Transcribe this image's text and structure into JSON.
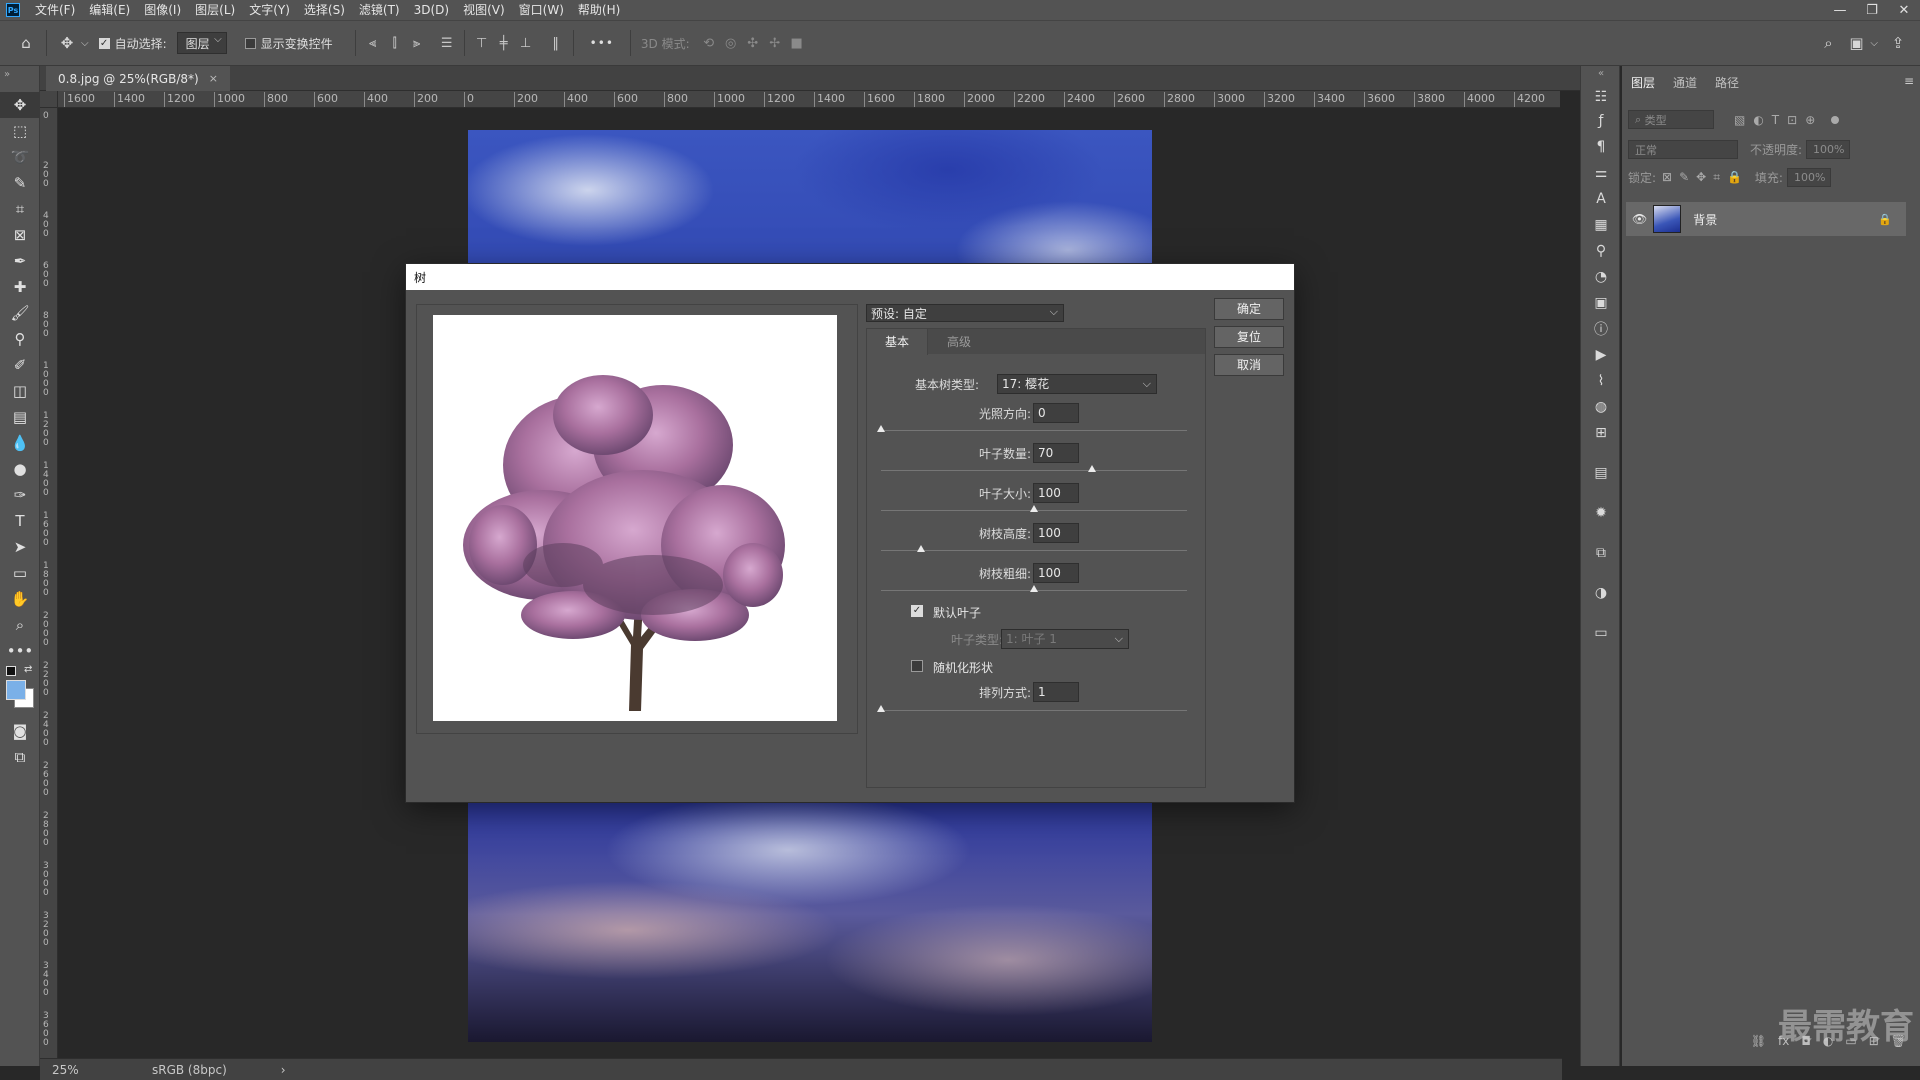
{
  "app": {
    "logo": "Ps"
  },
  "menu": [
    "文件(F)",
    "编辑(E)",
    "图像(I)",
    "图层(L)",
    "文字(Y)",
    "选择(S)",
    "滤镜(T)",
    "3D(D)",
    "视图(V)",
    "窗口(W)",
    "帮助(H)"
  ],
  "window_controls": {
    "minimize": "—",
    "restore": "❐",
    "close": "✕"
  },
  "options_bar": {
    "auto_select_label": "自动选择:",
    "auto_select_checked": true,
    "auto_select_target": "图层",
    "show_transform_label": "显示变换控件",
    "show_transform_checked": false,
    "more": "•••",
    "mode_3d_label": "3D 模式:"
  },
  "document_tab": {
    "title": "0.8.jpg @ 25%(RGB/8*)",
    "close": "×"
  },
  "ruler_h": [
    "1600",
    "1400",
    "1200",
    "1000",
    "800",
    "600",
    "400",
    "200",
    "0",
    "200",
    "400",
    "600",
    "800",
    "1000",
    "1200",
    "1400",
    "1600",
    "1800",
    "2000",
    "2200",
    "2400",
    "2600",
    "2800",
    "3000",
    "3200",
    "3400",
    "3600",
    "3800",
    "4000",
    "4200"
  ],
  "ruler_v": [
    "0",
    "2 0 0",
    "4 0 0",
    "6 0 0",
    "8 0 0",
    "1 0 0 0",
    "1 2 0 0",
    "1 4 0 0",
    "1 6 0 0",
    "1 8 0 0",
    "2 0 0 0",
    "2 2 0 0",
    "2 4 0 0",
    "2 6 0 0",
    "2 8 0 0",
    "3 0 0 0",
    "3 2 0 0",
    "3 4 0 0",
    "3 6 0 0"
  ],
  "status": {
    "zoom": "25%",
    "profile": "sRGB (8bpc)",
    "arrow": "›"
  },
  "layers_panel": {
    "tabs": [
      "图层",
      "通道",
      "路径"
    ],
    "filter_placeholder": "类型",
    "blend_mode": "正常",
    "opacity_label": "不透明度:",
    "opacity_value": "100%",
    "lock_label": "锁定:",
    "fill_label": "填充:",
    "fill_value": "100%",
    "layer_name": "背景",
    "footer_icons": [
      "⛓",
      "fx",
      "◘",
      "◐",
      "▭",
      "⊞",
      "🗑"
    ]
  },
  "dialog": {
    "title": "树",
    "preset": "预设: 自定",
    "tabs": [
      "基本",
      "高级"
    ],
    "active_tab": "基本",
    "base_tree_type_label": "基本树类型:",
    "base_tree_type_value": "17: 樱花",
    "params": [
      {
        "label": "光照方向:",
        "value": "0",
        "slider": 0.0
      },
      {
        "label": "叶子数量:",
        "value": "70",
        "slider": 0.69
      },
      {
        "label": "叶子大小:",
        "value": "100",
        "slider": 0.5
      },
      {
        "label": "树枝高度:",
        "value": "100",
        "slider": 0.13
      },
      {
        "label": "树枝粗细:",
        "value": "100",
        "slider": 0.5
      }
    ],
    "default_leaves_label": "默认叶子",
    "default_leaves_checked": true,
    "leaf_type_label": "叶子类型:",
    "leaf_type_value": "1: 叶子 1",
    "randomize_label": "随机化形状",
    "randomize_checked": false,
    "arrangement_label": "排列方式:",
    "arrangement_value": "1",
    "arrangement_slider": 0.0,
    "buttons": {
      "ok": "确定",
      "reset": "复位",
      "cancel": "取消"
    }
  },
  "watermark": "最需教育",
  "colors": {
    "accent": "#31a8ff",
    "blossom": "#b07aa8",
    "trunk": "#4a3a30"
  }
}
